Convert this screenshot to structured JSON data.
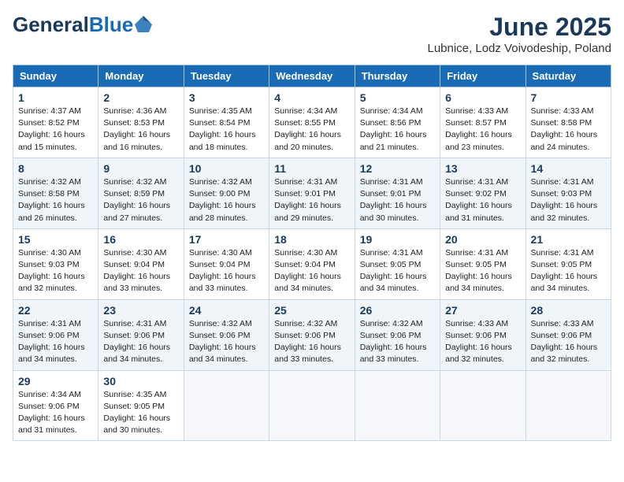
{
  "header": {
    "logo_general": "General",
    "logo_blue": "Blue",
    "title": "June 2025",
    "subtitle": "Lubnice, Lodz Voivodeship, Poland"
  },
  "columns": [
    "Sunday",
    "Monday",
    "Tuesday",
    "Wednesday",
    "Thursday",
    "Friday",
    "Saturday"
  ],
  "weeks": [
    [
      {
        "day": "1",
        "info": "Sunrise: 4:37 AM\nSunset: 8:52 PM\nDaylight: 16 hours\nand 15 minutes."
      },
      {
        "day": "2",
        "info": "Sunrise: 4:36 AM\nSunset: 8:53 PM\nDaylight: 16 hours\nand 16 minutes."
      },
      {
        "day": "3",
        "info": "Sunrise: 4:35 AM\nSunset: 8:54 PM\nDaylight: 16 hours\nand 18 minutes."
      },
      {
        "day": "4",
        "info": "Sunrise: 4:34 AM\nSunset: 8:55 PM\nDaylight: 16 hours\nand 20 minutes."
      },
      {
        "day": "5",
        "info": "Sunrise: 4:34 AM\nSunset: 8:56 PM\nDaylight: 16 hours\nand 21 minutes."
      },
      {
        "day": "6",
        "info": "Sunrise: 4:33 AM\nSunset: 8:57 PM\nDaylight: 16 hours\nand 23 minutes."
      },
      {
        "day": "7",
        "info": "Sunrise: 4:33 AM\nSunset: 8:58 PM\nDaylight: 16 hours\nand 24 minutes."
      }
    ],
    [
      {
        "day": "8",
        "info": "Sunrise: 4:32 AM\nSunset: 8:58 PM\nDaylight: 16 hours\nand 26 minutes."
      },
      {
        "day": "9",
        "info": "Sunrise: 4:32 AM\nSunset: 8:59 PM\nDaylight: 16 hours\nand 27 minutes."
      },
      {
        "day": "10",
        "info": "Sunrise: 4:32 AM\nSunset: 9:00 PM\nDaylight: 16 hours\nand 28 minutes."
      },
      {
        "day": "11",
        "info": "Sunrise: 4:31 AM\nSunset: 9:01 PM\nDaylight: 16 hours\nand 29 minutes."
      },
      {
        "day": "12",
        "info": "Sunrise: 4:31 AM\nSunset: 9:01 PM\nDaylight: 16 hours\nand 30 minutes."
      },
      {
        "day": "13",
        "info": "Sunrise: 4:31 AM\nSunset: 9:02 PM\nDaylight: 16 hours\nand 31 minutes."
      },
      {
        "day": "14",
        "info": "Sunrise: 4:31 AM\nSunset: 9:03 PM\nDaylight: 16 hours\nand 32 minutes."
      }
    ],
    [
      {
        "day": "15",
        "info": "Sunrise: 4:30 AM\nSunset: 9:03 PM\nDaylight: 16 hours\nand 32 minutes."
      },
      {
        "day": "16",
        "info": "Sunrise: 4:30 AM\nSunset: 9:04 PM\nDaylight: 16 hours\nand 33 minutes."
      },
      {
        "day": "17",
        "info": "Sunrise: 4:30 AM\nSunset: 9:04 PM\nDaylight: 16 hours\nand 33 minutes."
      },
      {
        "day": "18",
        "info": "Sunrise: 4:30 AM\nSunset: 9:04 PM\nDaylight: 16 hours\nand 34 minutes."
      },
      {
        "day": "19",
        "info": "Sunrise: 4:31 AM\nSunset: 9:05 PM\nDaylight: 16 hours\nand 34 minutes."
      },
      {
        "day": "20",
        "info": "Sunrise: 4:31 AM\nSunset: 9:05 PM\nDaylight: 16 hours\nand 34 minutes."
      },
      {
        "day": "21",
        "info": "Sunrise: 4:31 AM\nSunset: 9:05 PM\nDaylight: 16 hours\nand 34 minutes."
      }
    ],
    [
      {
        "day": "22",
        "info": "Sunrise: 4:31 AM\nSunset: 9:06 PM\nDaylight: 16 hours\nand 34 minutes."
      },
      {
        "day": "23",
        "info": "Sunrise: 4:31 AM\nSunset: 9:06 PM\nDaylight: 16 hours\nand 34 minutes."
      },
      {
        "day": "24",
        "info": "Sunrise: 4:32 AM\nSunset: 9:06 PM\nDaylight: 16 hours\nand 34 minutes."
      },
      {
        "day": "25",
        "info": "Sunrise: 4:32 AM\nSunset: 9:06 PM\nDaylight: 16 hours\nand 33 minutes."
      },
      {
        "day": "26",
        "info": "Sunrise: 4:32 AM\nSunset: 9:06 PM\nDaylight: 16 hours\nand 33 minutes."
      },
      {
        "day": "27",
        "info": "Sunrise: 4:33 AM\nSunset: 9:06 PM\nDaylight: 16 hours\nand 32 minutes."
      },
      {
        "day": "28",
        "info": "Sunrise: 4:33 AM\nSunset: 9:06 PM\nDaylight: 16 hours\nand 32 minutes."
      }
    ],
    [
      {
        "day": "29",
        "info": "Sunrise: 4:34 AM\nSunset: 9:06 PM\nDaylight: 16 hours\nand 31 minutes."
      },
      {
        "day": "30",
        "info": "Sunrise: 4:35 AM\nSunset: 9:05 PM\nDaylight: 16 hours\nand 30 minutes."
      },
      {
        "day": "",
        "info": ""
      },
      {
        "day": "",
        "info": ""
      },
      {
        "day": "",
        "info": ""
      },
      {
        "day": "",
        "info": ""
      },
      {
        "day": "",
        "info": ""
      }
    ]
  ]
}
